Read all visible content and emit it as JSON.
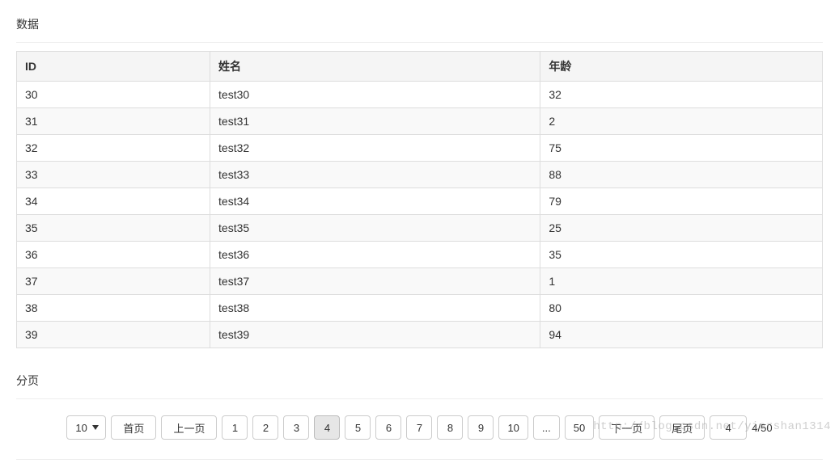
{
  "section_data_title": "数据",
  "section_page_title": "分页",
  "table": {
    "headers": {
      "id": "ID",
      "name": "姓名",
      "age": "年龄"
    },
    "rows": [
      {
        "id": "30",
        "name": "test30",
        "age": "32"
      },
      {
        "id": "31",
        "name": "test31",
        "age": "2"
      },
      {
        "id": "32",
        "name": "test32",
        "age": "75"
      },
      {
        "id": "33",
        "name": "test33",
        "age": "88"
      },
      {
        "id": "34",
        "name": "test34",
        "age": "79"
      },
      {
        "id": "35",
        "name": "test35",
        "age": "25"
      },
      {
        "id": "36",
        "name": "test36",
        "age": "35"
      },
      {
        "id": "37",
        "name": "test37",
        "age": "1"
      },
      {
        "id": "38",
        "name": "test38",
        "age": "80"
      },
      {
        "id": "39",
        "name": "test39",
        "age": "94"
      }
    ]
  },
  "pagination": {
    "page_size_selected": "10",
    "first_label": "首页",
    "prev_label": "上一页",
    "next_label": "下一页",
    "last_label": "尾页",
    "pages": [
      "1",
      "2",
      "3",
      "4",
      "5",
      "6",
      "7",
      "8",
      "9",
      "10"
    ],
    "ellipsis": "...",
    "last_page": "50",
    "current_page": "4",
    "current_input": "4",
    "info": "4/50"
  },
  "watermark": "http://blog.csdn.net/yiershan1314"
}
